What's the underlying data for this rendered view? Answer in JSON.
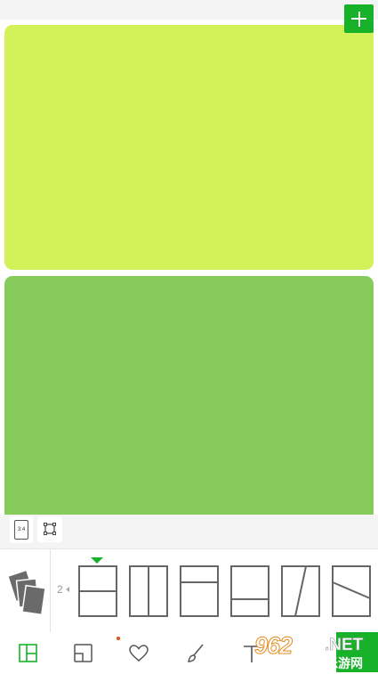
{
  "colors": {
    "accent": "#17b22a",
    "cell_top": "#d3f25a",
    "cell_bottom": "#87cb5d"
  },
  "toolbar": {
    "add_icon": "plus-icon",
    "ratio_label": "3:4",
    "crop_icon": "crop-icon"
  },
  "layout_panel": {
    "photo_count": "2",
    "selected_index": 0,
    "options": [
      {
        "name": "layout-two-rows"
      },
      {
        "name": "layout-two-columns"
      },
      {
        "name": "layout-small-top-large-bottom"
      },
      {
        "name": "layout-large-top-small-bottom"
      },
      {
        "name": "layout-diagonal-columns"
      },
      {
        "name": "layout-diagonal-rows"
      }
    ]
  },
  "bottom_tabs": [
    {
      "icon": "layout-icon",
      "active": true
    },
    {
      "icon": "frame-icon",
      "active": false
    },
    {
      "icon": "heart-icon",
      "active": false
    },
    {
      "icon": "brush-icon",
      "active": false
    },
    {
      "icon": "text-icon",
      "active": false
    }
  ],
  "watermark": {
    "number": "962",
    "suffix": ".NET",
    "chinese": "乐游网"
  }
}
